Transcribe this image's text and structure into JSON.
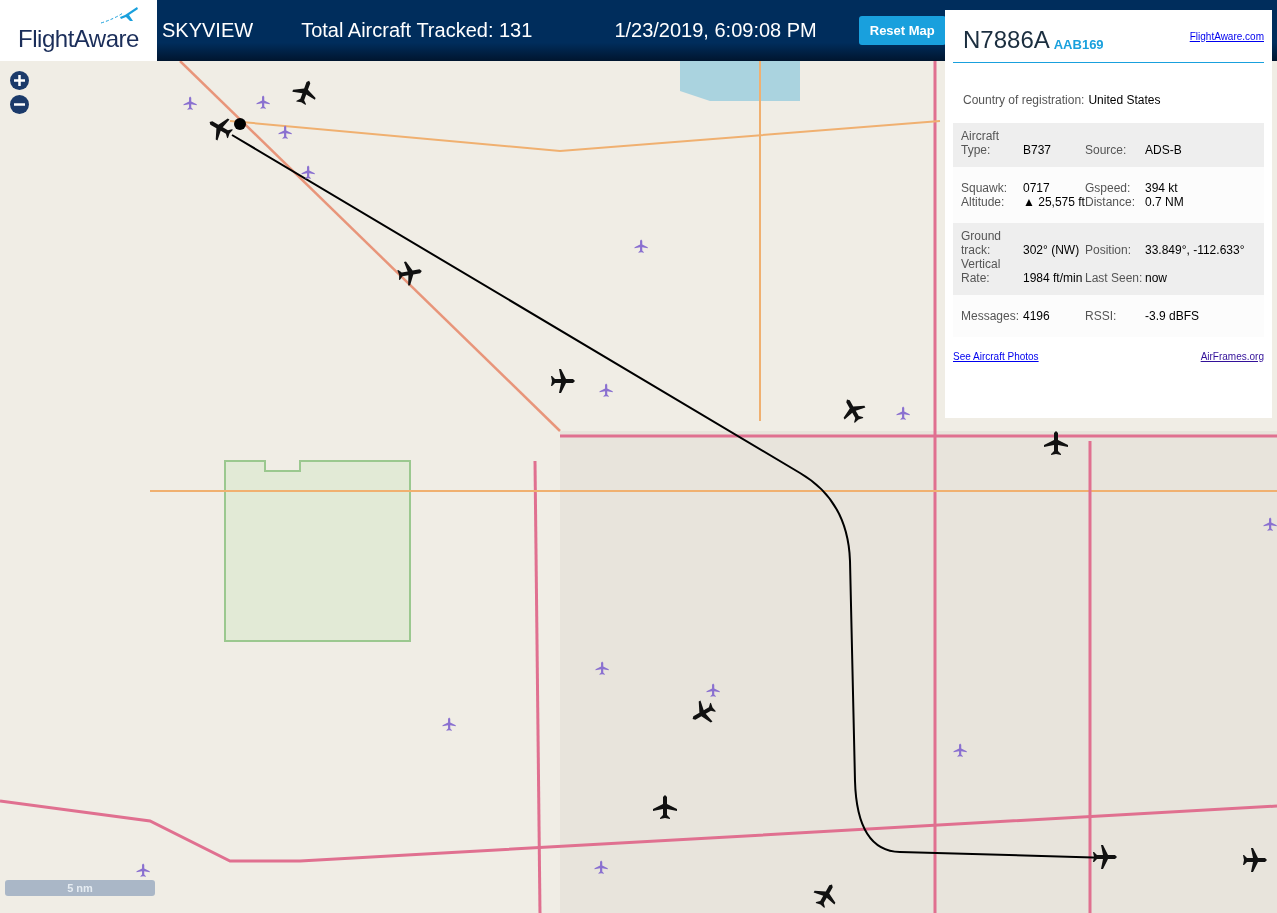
{
  "header": {
    "logo": "FlightAware",
    "title": "SKYVIEW",
    "tracked": "Total Aircraft Tracked: 131",
    "datetime": "1/23/2019, 6:09:08 PM",
    "reset_button": "Reset Map"
  },
  "map": {
    "scale": "5 nm"
  },
  "info_panel": {
    "registration": "N7886A",
    "callsign": "AAB169",
    "site_link": "FlightAware.com",
    "country_label": "Country of registration:",
    "country_value": "United States",
    "sections": [
      {
        "shaded": true,
        "rows": [
          {
            "label1": "Aircraft Type:",
            "value1": "B737",
            "label2": "Source:",
            "value2": "ADS-B"
          }
        ]
      },
      {
        "shaded": false,
        "rows": [
          {
            "label1": "Squawk:",
            "value1": "0717",
            "label2": "Gspeed:",
            "value2": "394 kt"
          },
          {
            "label1": "Altitude:",
            "value1": "▲ 25,575 ft",
            "label2": "Distance:",
            "value2": "0.7 NM"
          }
        ]
      },
      {
        "shaded": true,
        "rows": [
          {
            "label1": "Ground track:",
            "value1": "302° (NW)",
            "label2": "Position:",
            "value2": "33.849°, -112.633°"
          },
          {
            "label1": "Vertical Rate:",
            "value1": "1984 ft/min",
            "label2": "Last Seen:",
            "value2": "now"
          }
        ]
      },
      {
        "shaded": false,
        "rows": [
          {
            "label1": "Messages:",
            "value1": "4196",
            "label2": "RSSI:",
            "value2": "-3.9 dBFS"
          }
        ]
      }
    ],
    "photos_link": "See Aircraft Photos",
    "airframes_link": "AirFrames.org"
  }
}
